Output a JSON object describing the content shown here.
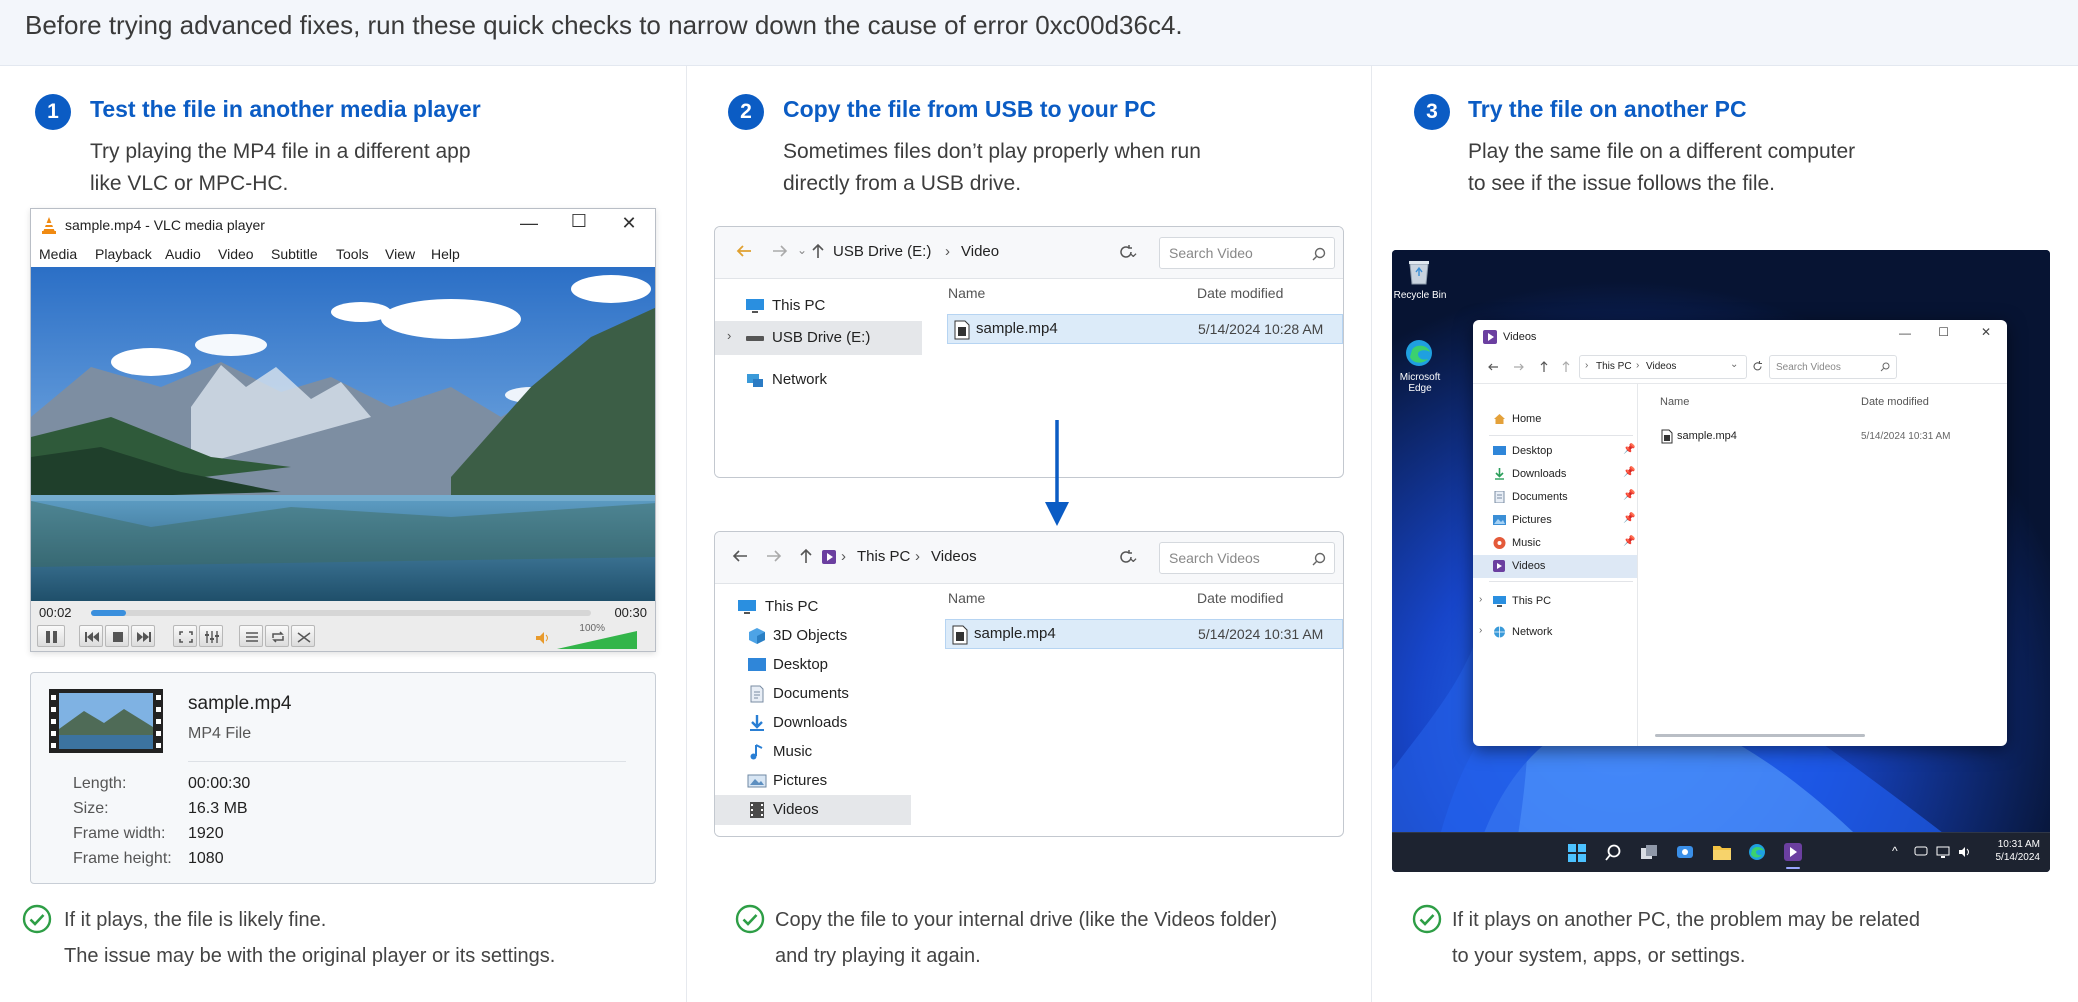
{
  "banner": {
    "text": "Before trying advanced fixes, run these quick checks to narrow down the cause of error 0xc00d36c4."
  },
  "steps": [
    {
      "number": "1",
      "title": "Test the file in another media player",
      "desc_line1": "Try playing the MP4 file in a different app",
      "desc_line2": "like VLC or MPC-HC.",
      "result_line1": "If it plays, the file is likely fine.",
      "result_line2": "The issue may be with the original player or its settings."
    },
    {
      "number": "2",
      "title": "Copy the file from USB to your PC",
      "desc_line1": "Sometimes files don’t play properly when run",
      "desc_line2": "directly from a USB drive.",
      "result_line1": "Copy the file to your internal drive (like the Videos folder)",
      "result_line2": "and try playing it again."
    },
    {
      "number": "3",
      "title": "Try the file on another PC",
      "desc_line1": "Play the same file on a different computer",
      "desc_line2": "to see if the issue follows the file.",
      "result_line1": "If it plays on another PC, the problem may be related",
      "result_line2": "to your system, apps, or settings."
    }
  ],
  "vlc": {
    "title": "sample.mp4 - VLC media player",
    "menu": [
      "Media",
      "Playback",
      "Audio",
      "Video",
      "Subtitle",
      "Tools",
      "View",
      "Help"
    ],
    "time_elapsed": "00:02",
    "time_total": "00:30",
    "progress_fraction": 0.07,
    "volume_label": "100%",
    "volume_fraction": 1.0
  },
  "file_info": {
    "name": "sample.mp4",
    "type": "MP4 File",
    "rows": [
      {
        "label": "Length:",
        "value": "00:00:30"
      },
      {
        "label": "Size:",
        "value": "16.3 MB"
      },
      {
        "label": "Frame width:",
        "value": "1920"
      },
      {
        "label": "Frame height:",
        "value": "1080"
      }
    ]
  },
  "explorer_usb": {
    "crumb_drive": "USB Drive (E:)",
    "crumb_folder": "Video",
    "search_placeholder": "Search Video",
    "nav": [
      {
        "label": "This PC",
        "icon": "monitor-icon"
      },
      {
        "label": "USB Drive (E:)",
        "icon": "drive-icon"
      },
      {
        "label": "Network",
        "icon": "network-icon"
      }
    ],
    "col_name": "Name",
    "col_date": "Date modified",
    "file_name": "sample.mp4",
    "file_date": "5/14/2024 10:28 AM"
  },
  "explorer_pc": {
    "crumb_root": "This PC",
    "crumb_folder": "Videos",
    "search_placeholder": "Search Videos",
    "nav": [
      {
        "label": "This PC",
        "icon": "monitor-icon"
      },
      {
        "label": "3D Objects",
        "icon": "cube-icon"
      },
      {
        "label": "Desktop",
        "icon": "desktop-icon"
      },
      {
        "label": "Documents",
        "icon": "document-icon"
      },
      {
        "label": "Downloads",
        "icon": "download-icon"
      },
      {
        "label": "Music",
        "icon": "music-icon"
      },
      {
        "label": "Pictures",
        "icon": "picture-icon"
      },
      {
        "label": "Videos",
        "icon": "video-icon"
      }
    ],
    "col_name": "Name",
    "col_date": "Date modified",
    "file_name": "sample.mp4",
    "file_date": "5/14/2024 10:31 AM"
  },
  "desktop": {
    "icons": [
      "Recycle Bin",
      "Microsoft Edge"
    ],
    "window_title": "Videos",
    "crumb_root": "This PC",
    "crumb_folder": "Videos",
    "search_placeholder": "Search Videos",
    "nav": [
      {
        "label": "Home",
        "pinned": false
      },
      {
        "label": "Desktop",
        "pinned": true
      },
      {
        "label": "Downloads",
        "pinned": true
      },
      {
        "label": "Documents",
        "pinned": true
      },
      {
        "label": "Pictures",
        "pinned": true
      },
      {
        "label": "Music",
        "pinned": true
      },
      {
        "label": "Videos",
        "pinned": false
      },
      {
        "label": "This PC",
        "pinned": false
      },
      {
        "label": "Network",
        "pinned": false
      }
    ],
    "col_name": "Name",
    "col_date": "Date modified",
    "file_name": "sample.mp4",
    "file_date": "5/14/2024 10:31 AM",
    "clock_time": "10:31 AM",
    "clock_date": "5/14/2024"
  },
  "colors": {
    "accent": "#0b5cc4",
    "success": "#2e9e46",
    "selection": "#dcebf9"
  }
}
